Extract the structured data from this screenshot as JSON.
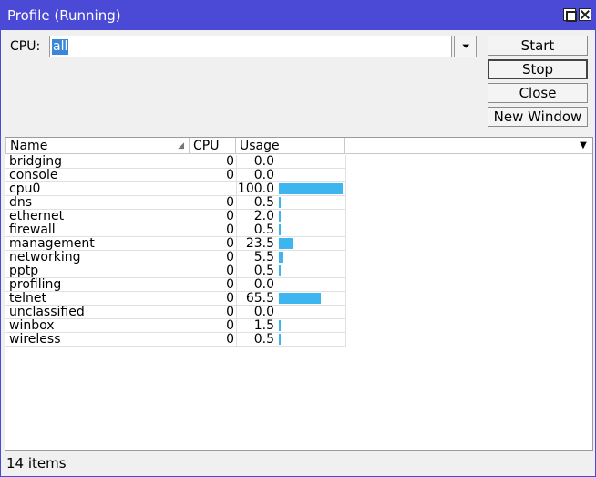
{
  "window": {
    "title": "Profile (Running)"
  },
  "cpu": {
    "label": "CPU:",
    "value": "all"
  },
  "buttons": {
    "start": "Start",
    "stop": "Stop",
    "close": "Close",
    "new_window": "New Window"
  },
  "table": {
    "columns": [
      "Name",
      "CPU",
      "Usage"
    ],
    "rows": [
      {
        "name": "bridging",
        "cpu": "0",
        "usage": "0.0",
        "usage_pct": 0
      },
      {
        "name": "console",
        "cpu": "0",
        "usage": "0.0",
        "usage_pct": 0
      },
      {
        "name": "cpu0",
        "cpu": "",
        "usage": "100.0",
        "usage_pct": 100
      },
      {
        "name": "dns",
        "cpu": "0",
        "usage": "0.5",
        "usage_pct": 0.5
      },
      {
        "name": "ethernet",
        "cpu": "0",
        "usage": "2.0",
        "usage_pct": 2
      },
      {
        "name": "firewall",
        "cpu": "0",
        "usage": "0.5",
        "usage_pct": 0.5
      },
      {
        "name": "management",
        "cpu": "0",
        "usage": "23.5",
        "usage_pct": 23.5
      },
      {
        "name": "networking",
        "cpu": "0",
        "usage": "5.5",
        "usage_pct": 5.5
      },
      {
        "name": "pptp",
        "cpu": "0",
        "usage": "0.5",
        "usage_pct": 0.5
      },
      {
        "name": "profiling",
        "cpu": "0",
        "usage": "0.0",
        "usage_pct": 0
      },
      {
        "name": "telnet",
        "cpu": "0",
        "usage": "65.5",
        "usage_pct": 65.5
      },
      {
        "name": "unclassified",
        "cpu": "0",
        "usage": "0.0",
        "usage_pct": 0
      },
      {
        "name": "winbox",
        "cpu": "0",
        "usage": "1.5",
        "usage_pct": 1.5
      },
      {
        "name": "wireless",
        "cpu": "0",
        "usage": "0.5",
        "usage_pct": 0.5
      }
    ]
  },
  "status": {
    "count": "14 items"
  },
  "colors": {
    "titlebar": "#4a4ad6",
    "usage_bar": "#3db6ef",
    "selection": "#3b86d8"
  },
  "icons": {
    "restore": "restore-icon",
    "close": "close-icon",
    "dropdown": "dropdown-arrow-icon",
    "sort": "sort-icon",
    "column_menu": "column-menu-icon"
  }
}
